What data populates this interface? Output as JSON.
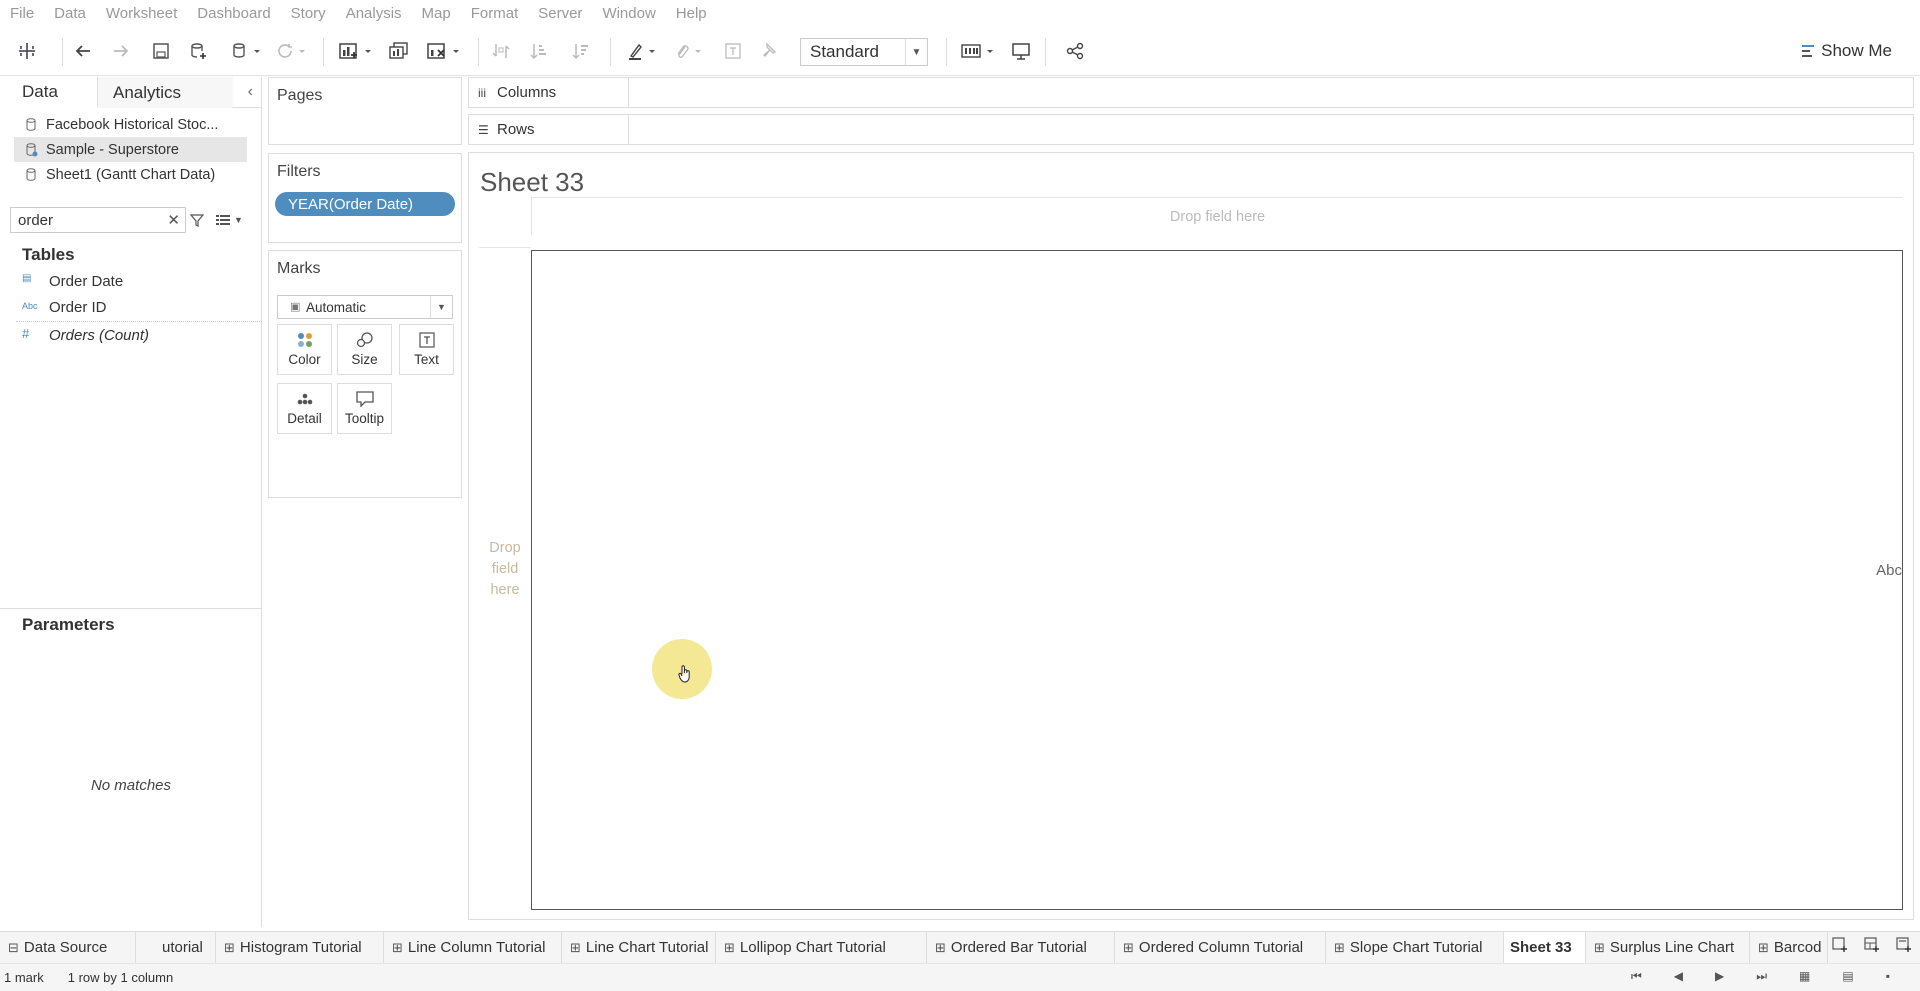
{
  "menu": [
    "File",
    "Data",
    "Worksheet",
    "Dashboard",
    "Story",
    "Analysis",
    "Map",
    "Format",
    "Server",
    "Window",
    "Help"
  ],
  "toolbar": {
    "fit_value": "Standard",
    "show_me": "Show Me",
    "icons": [
      "tableau-logo-icon",
      "undo-icon",
      "redo-icon",
      "save-icon",
      "new-datasource-icon",
      "pause-updates-icon",
      "refresh-icon",
      "new-worksheet-icon",
      "duplicate-sheet-icon",
      "clear-sheet-icon",
      "swap-icon",
      "sort-ascending-icon",
      "sort-descending-icon",
      "highlight-icon",
      "group-icon",
      "labels-icon",
      "pin-icon",
      "cards-icon",
      "presentation-icon",
      "share-icon",
      "show-me-icon"
    ]
  },
  "data_pane": {
    "tab_data": "Data",
    "tab_analytics": "Analytics",
    "datasources": [
      "Facebook Historical Stoc...",
      "Sample - Superstore",
      "Sheet1 (Gantt Chart Data)"
    ],
    "search_value": "order",
    "tables_heading": "Tables",
    "fields": [
      {
        "type": "date",
        "icon_text": "▤",
        "name": "Order Date"
      },
      {
        "type": "string",
        "icon_text": "Abc",
        "name": "Order ID"
      },
      {
        "type": "number",
        "icon_text": "#",
        "name": "Orders (Count)"
      }
    ],
    "parameters_heading": "Parameters",
    "parameters_empty": "No matches"
  },
  "pages": {
    "title": "Pages"
  },
  "filters": {
    "title": "Filters",
    "pill": "YEAR(Order Date)"
  },
  "marks": {
    "title": "Marks",
    "type": "Automatic",
    "buttons": {
      "color": "Color",
      "size": "Size",
      "text": "Text",
      "detail": "Detail",
      "tooltip": "Tooltip"
    }
  },
  "shelves": {
    "columns": "Columns",
    "rows": "Rows"
  },
  "view": {
    "title": "Sheet 33",
    "drop_columns": "Drop field here",
    "drop_rows": [
      "Drop",
      "field",
      "here"
    ],
    "placeholder": "Abc"
  },
  "tabs": [
    {
      "label": "Data Source",
      "icon": "⊟"
    },
    {
      "label": "utorial",
      "icon": ""
    },
    {
      "label": "Histogram Tutorial",
      "icon": "⊞"
    },
    {
      "label": "Line Column Tutorial",
      "icon": "⊞"
    },
    {
      "label": "Line Chart Tutorial",
      "icon": "⊞"
    },
    {
      "label": "Lollipop Chart Tutorial",
      "icon": "⊞"
    },
    {
      "label": "Ordered Bar Tutorial",
      "icon": "⊞"
    },
    {
      "label": "Ordered Column Tutorial",
      "icon": "⊞"
    },
    {
      "label": "Slope Chart Tutorial",
      "icon": "⊞"
    },
    {
      "label": "Sheet 33",
      "icon": ""
    },
    {
      "label": "Surplus Line Chart",
      "icon": "⊞"
    },
    {
      "label": "Barcod",
      "icon": "⊞"
    }
  ],
  "status": {
    "marks": "1 mark",
    "shape": "1 row by 1 column"
  }
}
